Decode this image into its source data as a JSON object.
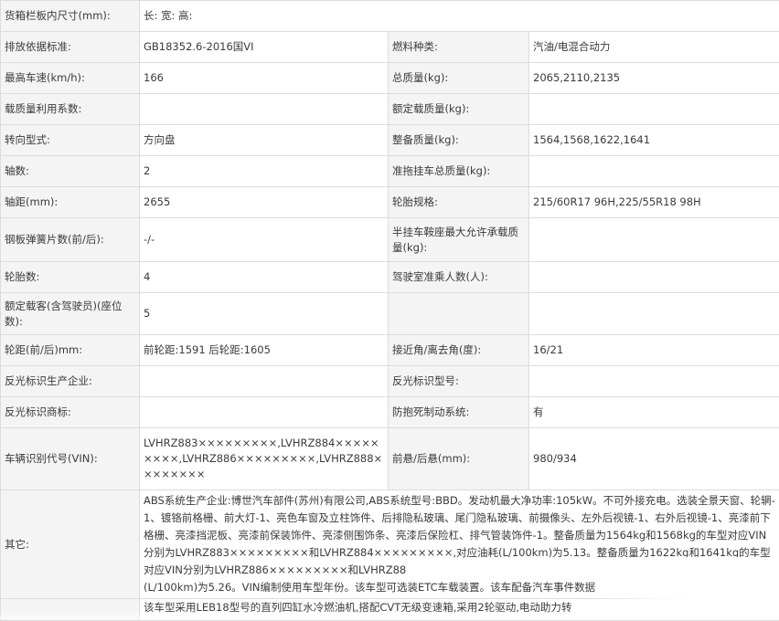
{
  "rows": [
    {
      "l1": "货箱栏板内尺寸(mm):",
      "v1": "长:  宽:  高:"
    },
    {
      "l1": "排放依据标准:",
      "v1": "GB18352.6-2016国VI",
      "l2": "燃料种类:",
      "v2": "汽油/电混合动力"
    },
    {
      "l1": "最高车速(km/h):",
      "v1": "166",
      "l2": "总质量(kg):",
      "v2": "2065,2110,2135"
    },
    {
      "l1": "载质量利用系数:",
      "v1": "",
      "l2": "额定载质量(kg):",
      "v2": ""
    },
    {
      "l1": "转向型式:",
      "v1": "方向盘",
      "l2": "整备质量(kg):",
      "v2": "1564,1568,1622,1641"
    },
    {
      "l1": "轴数:",
      "v1": "2",
      "l2": "准拖挂车总质量(kg):",
      "v2": ""
    },
    {
      "l1": "轴距(mm):",
      "v1": "2655",
      "l2": "轮胎规格:",
      "v2": "215/60R17 96H,225/55R18 98H"
    },
    {
      "l1": "钢板弹簧片数(前/后):",
      "v1": "-/-",
      "l2": "半挂车鞍座最大允许承载质量(kg):",
      "v2": ""
    },
    {
      "l1": "轮胎数:",
      "v1": "4",
      "l2": "驾驶室准乘人数(人):",
      "v2": ""
    },
    {
      "l1": "额定载客(含驾驶员)(座位数):",
      "v1": "5",
      "l2": "",
      "v2": ""
    },
    {
      "l1": "轮距(前/后)mm:",
      "v1": "前轮距:1591 后轮距:1605",
      "l2": "接近角/离去角(度):",
      "v2": "16/21"
    },
    {
      "l1": "反光标识生产企业:",
      "v1": "",
      "l2": "反光标识型号:",
      "v2": ""
    },
    {
      "l1": "反光标识商标:",
      "v1": "",
      "l2": "防抱死制动系统:",
      "v2": "有"
    },
    {
      "l1": "车辆识别代号(VIN):",
      "v1": "LVHRZ883×××××××××,LVHRZ884×××××××××,LVHRZ886×××××××××,LVHRZ888××××××××",
      "l2": "前悬/后悬(mm):",
      "v2": "980/934"
    }
  ],
  "other": {
    "label": "其它:",
    "text": "ABS系统生产企业:博世汽车部件(苏州)有限公司,ABS系统型号:BBD。发动机最大净功率:105kW。不可外接充电。选装全景天窗、轮辋-1、镀铬前格栅、前大灯-1、亮色车窗及立柱饰件、后排隐私玻璃、尾门隐私玻璃、前摄像头、左外后视镜-1、右外后视镜-1、亮漆前下格栅、亮漆挡泥板、亮漆前保装饰件、亮漆侧围饰条、亮漆后保险杠、排气管装饰件-1。整备质量为1564kg和1568kg的车型对应VIN分别为LVHRZ883×××××××××和LVHRZ884×××××××××,对应油耗(L/100km)为5.13。整备质量为1622kg和1641kg的车型对应VIN分别为LVHRZ886×××××××××和LVHRZ88",
    "text2": "(L/100km)为5.26。VIN编制使用车型年份。该车型可选装ETC车载装置。该车配备汽车事件数据",
    "text3": "该车型采用LEB18型号的直列四缸水冷燃油机,搭配CVT无级变速箱,采用2轮驱动,电动助力转"
  }
}
